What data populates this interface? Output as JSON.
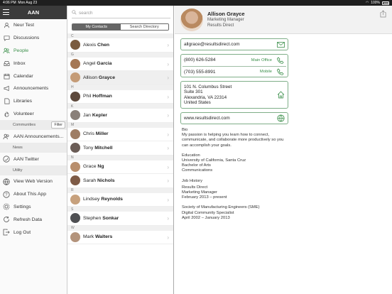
{
  "status": {
    "time": "4:06 PM",
    "date": "Mon Aug 23",
    "battery": "100%"
  },
  "sidebar": {
    "title": "AAN",
    "items": [
      {
        "label": "Neur Test",
        "icon": "person-icon"
      },
      {
        "label": "Discussions",
        "icon": "chat-bubble-icon"
      },
      {
        "label": "People",
        "icon": "people-icon",
        "active": true
      },
      {
        "label": "Inbox",
        "icon": "inbox-icon"
      },
      {
        "label": "Calendar",
        "icon": "calendar-icon"
      },
      {
        "label": "Announcements",
        "icon": "megaphone-icon"
      },
      {
        "label": "Libraries",
        "icon": "library-icon"
      },
      {
        "label": "Volunteer",
        "icon": "hand-icon"
      }
    ],
    "communities_label": "Communities",
    "filter_label": "Filter",
    "community_item": "AAN Announcements...",
    "news_label": "News",
    "news_item": "AAN Twitter",
    "utility_label": "Utility",
    "utility_items": [
      {
        "label": "View Web Version",
        "icon": "globe-icon"
      },
      {
        "label": "About This App",
        "icon": "help-icon"
      },
      {
        "label": "Settings",
        "icon": "gear-icon"
      },
      {
        "label": "Refresh Data",
        "icon": "refresh-icon"
      },
      {
        "label": "Log Out",
        "icon": "logout-icon"
      }
    ]
  },
  "contacts": {
    "search_placeholder": "search",
    "tabs": {
      "my": "My Contacts",
      "directory": "Search Directory"
    },
    "letters": [
      "C",
      "G",
      "H",
      "K",
      "M",
      "N",
      "R",
      "S",
      "W"
    ],
    "people": [
      {
        "first": "Alexis",
        "last": "Chen",
        "color": "#7a5b3f"
      },
      {
        "first": "Angel",
        "last": "Garcia",
        "color": "#a57754"
      },
      {
        "first": "Allison",
        "last": "Grayce",
        "color": "#c49b76"
      },
      {
        "first": "Phil",
        "last": "Hoffman",
        "color": "#5e4a3d"
      },
      {
        "first": "Jan",
        "last": "Kepler",
        "color": "#8a8079"
      },
      {
        "first": "Chris",
        "last": "Miller",
        "color": "#9e7d64"
      },
      {
        "first": "Tony",
        "last": "Mitchell",
        "color": "#6a5c56"
      },
      {
        "first": "Grace",
        "last": "Ng",
        "color": "#b88e6c"
      },
      {
        "first": "Sarah",
        "last": "Nichols",
        "color": "#7e5b46"
      },
      {
        "first": "Lindsey",
        "last": "Reynolds",
        "color": "#c7a17d"
      },
      {
        "first": "Stephen",
        "last": "Sonkar",
        "color": "#4e4f52"
      },
      {
        "first": "Mark",
        "last": "Walters",
        "color": "#b3937b"
      }
    ]
  },
  "detail": {
    "name": "Allison Grayce",
    "title": "Marketing Manager",
    "company": "Results Direct",
    "email": "allgrace@resultsdirect.com",
    "phone_main": "(800) 626-5284",
    "phone_main_label": "Main Office",
    "phone_mobile": "(703) 555-8991",
    "phone_mobile_label": "Mobile",
    "address": [
      "101 N. Columbus Street",
      "Suite 301",
      "Alexandria, VA 22314",
      "United States"
    ],
    "website": "www.resultsdirect.com",
    "bio_label": "Bio",
    "bio_text": "My passion is helping you learn how to connect, communicate, and collaborate more productively so you can accomplish your goals.",
    "education_label": "Education",
    "education": [
      "University of California, Santa Cruz",
      "Bachelor of Arts",
      "Communications"
    ],
    "jobs_label": "Job History",
    "jobs": [
      [
        "Results Direct",
        "Marketing Manager",
        "February 2013 – present"
      ],
      [
        "Society of Manufacturing Engineers (SME)",
        "Digital Community Specialist",
        "April 2002 – January 2013"
      ]
    ]
  }
}
